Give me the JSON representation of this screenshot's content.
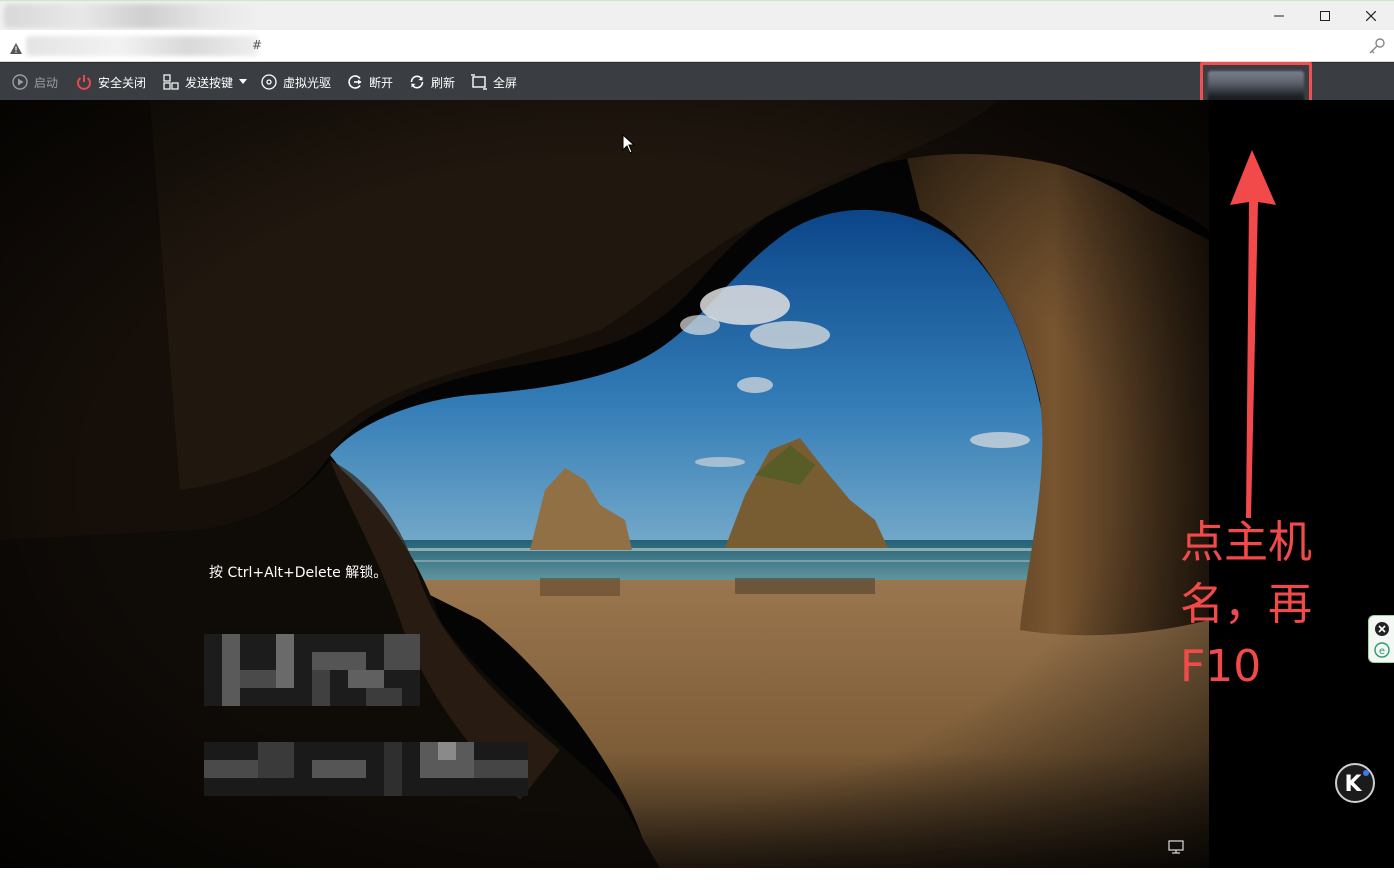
{
  "window": {
    "title": "",
    "address_suffix": "#",
    "controls": {
      "minimize": "minimize",
      "maximize": "maximize",
      "close": "close"
    }
  },
  "toolbar": {
    "start": "启动",
    "safe_shutdown": "安全关闭",
    "send_keys": "发送按键",
    "virtual_drive": "虚拟光驱",
    "disconnect": "断开",
    "refresh": "刷新",
    "fullscreen": "全屏",
    "hostname": ""
  },
  "lockscreen": {
    "hint": "按 Ctrl+Alt+Delete 解锁。"
  },
  "annotation": {
    "line1": "点主机",
    "line2": "名，再",
    "line3": "F10"
  },
  "colors": {
    "toolbar_bg": "#3a3d42",
    "shutdown_red": "#e84a4a",
    "annotation_red": "#f24a4a",
    "titlebar_bg": "#f0f0f0"
  },
  "icons": [
    "play-icon",
    "power-icon",
    "keyboard-icon",
    "disc-icon",
    "disconnect-icon",
    "refresh-icon",
    "fullscreen-icon",
    "warning-icon",
    "key-icon",
    "network-icon",
    "k-badge-icon"
  ]
}
